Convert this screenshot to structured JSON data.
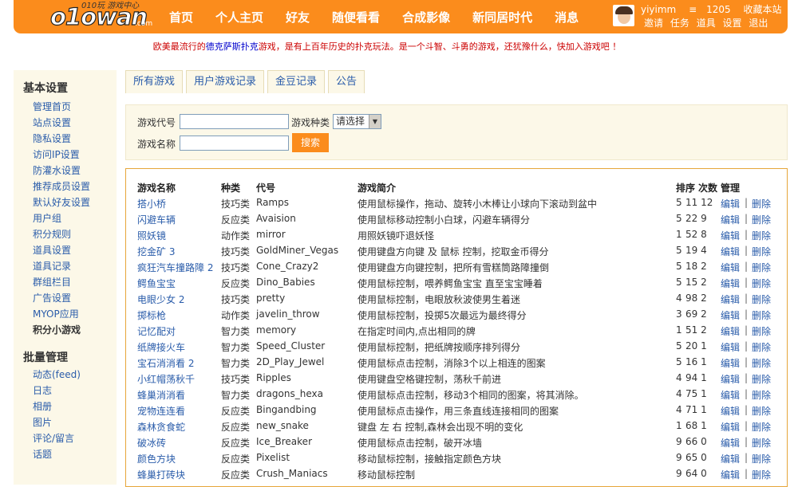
{
  "logo": {
    "main": "o1owan",
    "sub": "010玩 游戏中心",
    "com": ".com"
  },
  "nav": [
    "首页",
    "个人主页",
    "好友",
    "随便看看",
    "合成影像",
    "新同居时代",
    "消息"
  ],
  "user": {
    "name": "yiyimm",
    "points": "1205",
    "bookmark": "收藏本站",
    "links": [
      "邀请",
      "任务",
      "道具",
      "设置",
      "退出"
    ]
  },
  "notice": {
    "before": "欧美最流行的",
    "highlight": "德克萨斯扑克",
    "after": "游戏，是有上百年历史的扑克玩法。是一个斗智、斗勇的游戏，还犹豫什么，快加入游戏吧 ！"
  },
  "sidebar": {
    "section1": "基本设置",
    "items1": [
      "管理首页",
      "站点设置",
      "隐私设置",
      "访问IP设置",
      "防灌水设置",
      "推荐成员设置",
      "默认好友设置",
      "用户组",
      "积分规则",
      "道具设置",
      "道具记录",
      "群组栏目",
      "广告设置",
      "MYOP应用",
      "积分小游戏"
    ],
    "section2": "批量管理",
    "items2": [
      "动态(feed)",
      "日志",
      "相册",
      "图片",
      "评论/留言",
      "话题"
    ]
  },
  "tabs": [
    "所有游戏",
    "用户游戏记录",
    "金豆记录",
    "公告"
  ],
  "search": {
    "code_label": "游戏代号",
    "type_label": "游戏种类",
    "type_value": "请选择",
    "name_label": "游戏名称",
    "button": "搜索"
  },
  "table": {
    "headers": {
      "name": "游戏名称",
      "type": "种类",
      "code": "代号",
      "desc": "游戏简介",
      "order": "排序",
      "count": "次数",
      "manage": "管理"
    },
    "edit": "编辑",
    "sep": "|",
    "del": "删除",
    "rows": [
      {
        "name": "搭小桥",
        "type": "技巧类",
        "code": "Ramps",
        "desc": "使用鼠标操作，拖动、旋转小木棒让小球向下滚动到盆中",
        "order": "5",
        "count": "11 12"
      },
      {
        "name": "闪避车辆",
        "type": "反应类",
        "code": "Avaision",
        "desc": "使用鼠标移动控制小白球，闪避车辆得分",
        "order": "5",
        "count": "22 9"
      },
      {
        "name": "照妖镜",
        "type": "动作类",
        "code": "mirror",
        "desc": "用照妖镜吓退妖怪",
        "order": "1",
        "count": "52 8"
      },
      {
        "name": "挖金矿 3",
        "type": "技巧类",
        "code": "GoldMiner_Vegas",
        "desc": "使用键盘方向键 及 鼠标 控制，挖取金币得分",
        "order": "5",
        "count": "19 4"
      },
      {
        "name": "疯狂汽车撞路障 2",
        "type": "技巧类",
        "code": "Cone_Crazy2",
        "desc": "使用键盘方向键控制，把所有雪糕筒路障撞倒",
        "order": "5",
        "count": "18 2"
      },
      {
        "name": "鳄鱼宝宝",
        "type": "反应类",
        "code": "Dino_Babies",
        "desc": "使用鼠标控制，喂养鳄鱼宝宝 直至宝宝睡着",
        "order": "5",
        "count": "15 2"
      },
      {
        "name": "电眼少女 2",
        "type": "技巧类",
        "code": "pretty",
        "desc": "使用鼠标控制，电眼放秋波使男生着迷",
        "order": "4",
        "count": "98 2"
      },
      {
        "name": "掷标枪",
        "type": "动作类",
        "code": "javelin_throw",
        "desc": "使用鼠标控制，投掷5次最远为最终得分",
        "order": "3",
        "count": "69 2"
      },
      {
        "name": "记忆配对",
        "type": "智力类",
        "code": "memory",
        "desc": "在指定时间内,点出相同的牌",
        "order": "1",
        "count": "51 2"
      },
      {
        "name": "纸牌接火车",
        "type": "智力类",
        "code": "Speed_Cluster",
        "desc": "使用鼠标控制，把纸牌按顺序排列得分",
        "order": "5",
        "count": "20 1"
      },
      {
        "name": "宝石消消看 2",
        "type": "智力类",
        "code": "2D_Play_Jewel",
        "desc": "使用鼠标点击控制，消除3个以上相连的图案",
        "order": "5",
        "count": "16 1"
      },
      {
        "name": "小红帽荡秋千",
        "type": "技巧类",
        "code": "Ripples",
        "desc": "使用键盘空格键控制，荡秋千前进",
        "order": "4",
        "count": "94 1"
      },
      {
        "name": "蜂巢消消看",
        "type": "智力类",
        "code": "dragons_hexa",
        "desc": "使用鼠标点击控制，移动3个相同的图案，将其消除。",
        "order": "4",
        "count": "75 1"
      },
      {
        "name": "宠物连连看",
        "type": "反应类",
        "code": "Bingandbing",
        "desc": "使用鼠标点击操作，用三条直线连接相同的图案",
        "order": "4",
        "count": "71 1"
      },
      {
        "name": "森林贪食蛇",
        "type": "反应类",
        "code": "new_snake",
        "desc": "键盘 左 右 控制,森林会出现不明的变化",
        "order": "1",
        "count": "68 1"
      },
      {
        "name": "破冰砖",
        "type": "反应类",
        "code": "Ice_Breaker",
        "desc": "使用鼠标点击控制，破开冰墙",
        "order": "9",
        "count": "66 0"
      },
      {
        "name": "颜色方块",
        "type": "反应类",
        "code": "Pixelist",
        "desc": "移动鼠标控制，接触指定颜色方块",
        "order": "9",
        "count": "65 0"
      },
      {
        "name": "蜂巢打砖块",
        "type": "反应类",
        "code": "Crush_Maniacs",
        "desc": "移动鼠标控制",
        "order": "9",
        "count": "64 0"
      }
    ]
  },
  "colors": {
    "brand_orange": "#fb8c1c",
    "link_blue": "#2a5caa",
    "panel_bg": "#fcf8e8"
  }
}
